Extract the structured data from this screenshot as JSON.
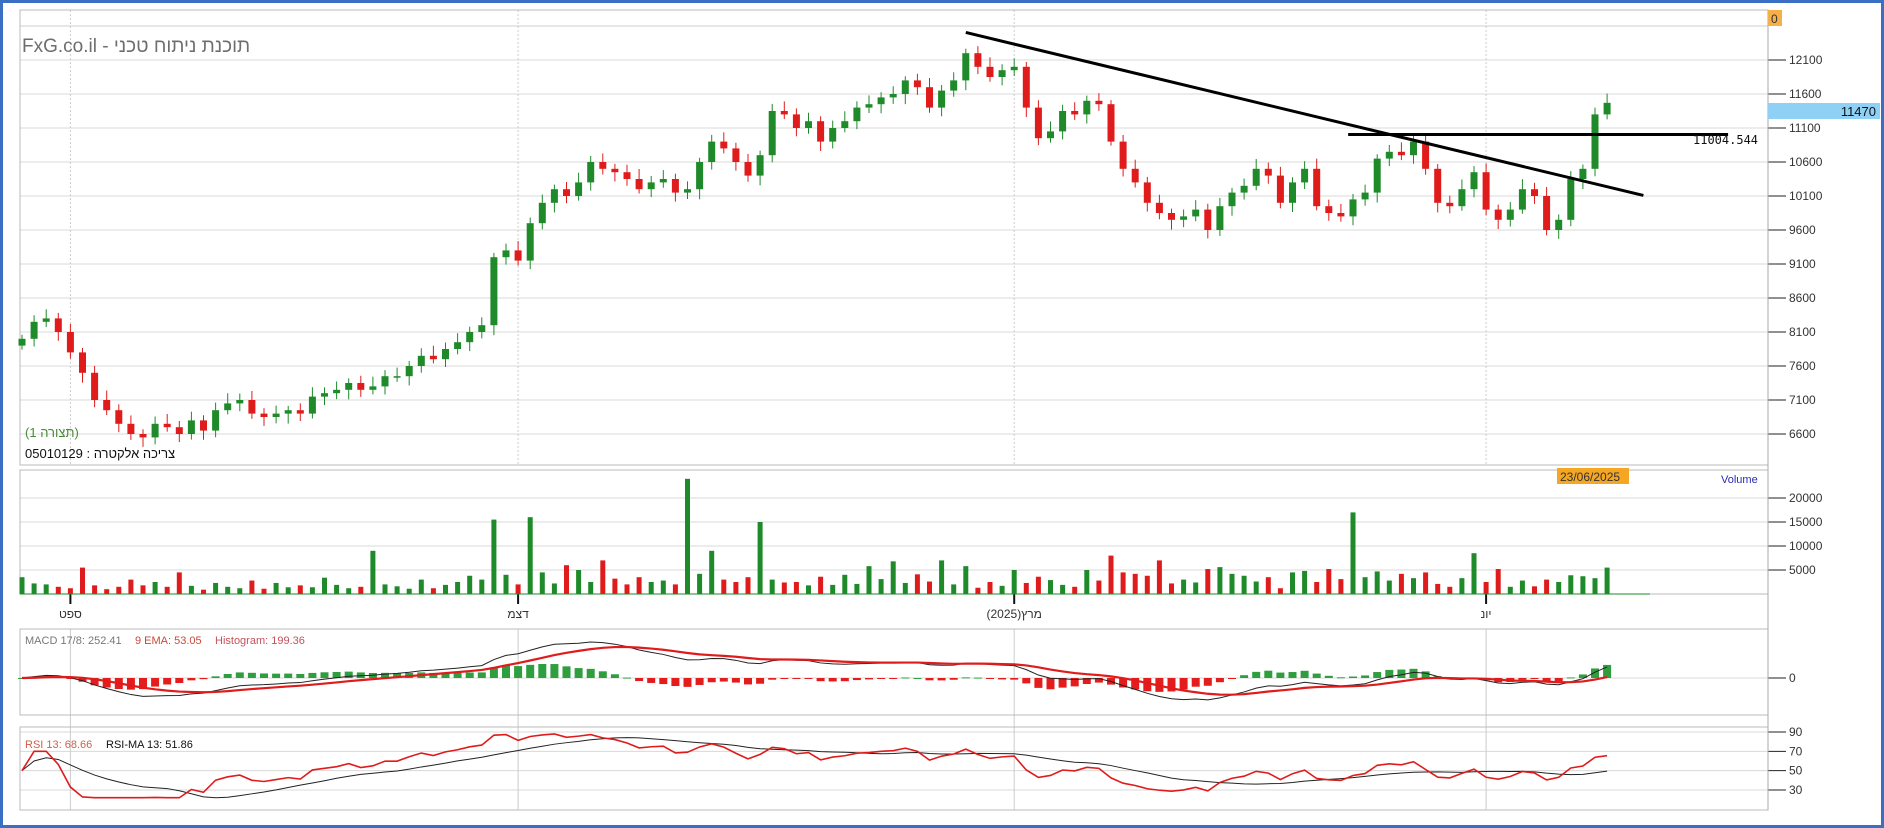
{
  "header": {
    "title": "FxG.co.il - תוכנת ניתוח טכני",
    "layout_label": "(תצורה 1)",
    "instrument": "05010129 : צריכה אלקטרה",
    "top_badge": "0",
    "last_price_badge": "11470",
    "date_badge": "23/06/2025",
    "volume_label": "Volume",
    "hline_label": "11004.544"
  },
  "indicators": {
    "macd_label": "MACD 17/8: 252.41",
    "ema_label": "9 EMA: 53.05",
    "hist_label": "Histogram: 199.36",
    "rsi_label": "RSI 13: 68.66",
    "rsima_label": "RSI-MA 13: 51.86"
  },
  "colors": {
    "up": "#1e8a2a",
    "down": "#e01b1b",
    "trend": "#000000",
    "badge": "#f5b04a",
    "price_badge": "#8fd0f5",
    "volume_text": "#2b2bb0"
  },
  "chart_data": {
    "type": "candlestick",
    "price_ticks": [
      12100,
      11600,
      11100,
      10600,
      10100,
      9600,
      9100,
      8600,
      8100,
      7600,
      7100,
      6600
    ],
    "volume_ticks": [
      20000,
      15000,
      10000,
      5000
    ],
    "macd_ticks": [
      0
    ],
    "rsi_ticks": [
      90,
      70,
      50,
      30
    ],
    "months": [
      {
        "label": "ספט",
        "index": 4
      },
      {
        "label": "דצמ",
        "index": 41
      },
      {
        "label": "מרץ(2025)",
        "index": 82
      },
      {
        "label": "יונ",
        "index": 121
      }
    ],
    "close": [
      8000,
      8250,
      8300,
      8100,
      7800,
      7500,
      7100,
      6950,
      6750,
      6600,
      6550,
      6750,
      6700,
      6600,
      6800,
      6650,
      6950,
      7050,
      7100,
      6900,
      6850,
      6900,
      6950,
      6900,
      7150,
      7200,
      7250,
      7350,
      7250,
      7300,
      7450,
      7450,
      7600,
      7750,
      7700,
      7850,
      7950,
      8100,
      8200,
      9200,
      9300,
      9150,
      9700,
      10000,
      10200,
      10100,
      10300,
      10600,
      10500,
      10450,
      10350,
      10200,
      10300,
      10350,
      10150,
      10200,
      10600,
      10900,
      10800,
      10600,
      10400,
      10700,
      11350,
      11300,
      11100,
      11200,
      10900,
      11100,
      11200,
      11400,
      11450,
      11550,
      11600,
      11800,
      11700,
      11400,
      11650,
      11800,
      12200,
      12000,
      11850,
      11950,
      12000,
      11400,
      10950,
      11050,
      11350,
      11300,
      11500,
      11450,
      10900,
      10500,
      10300,
      10000,
      9850,
      9750,
      9800,
      9900,
      9600,
      9950,
      10150,
      10250,
      10500,
      10400,
      10000,
      10300,
      10500,
      9950,
      9850,
      9800,
      10050,
      10150,
      10650,
      10750,
      10700,
      10900,
      10500,
      10000,
      9950,
      10200,
      10450,
      9900,
      9750,
      9900,
      10200,
      10100,
      9600,
      9750,
      10350,
      10500,
      11300,
      11470
    ],
    "volume": [
      3500,
      2200,
      2000,
      1500,
      1200,
      5500,
      1800,
      1000,
      1500,
      3000,
      1800,
      2500,
      1500,
      4500,
      1700,
      900,
      2300,
      1500,
      1200,
      2800,
      1100,
      2300,
      1400,
      1800,
      1400,
      3400,
      1900,
      1200,
      1500,
      9000,
      2000,
      1600,
      1100,
      3000,
      1200,
      1900,
      2500,
      3800,
      3000,
      15500,
      4000,
      2000,
      16000,
      4500,
      2200,
      6000,
      5000,
      2500,
      7000,
      3200,
      2000,
      3500,
      2500,
      2800,
      2000,
      24000,
      4200,
      9000,
      3000,
      2500,
      3500,
      15000,
      3000,
      2400,
      2500,
      1800,
      3600,
      1900,
      4000,
      2100,
      5800,
      3100,
      6800,
      2300,
      4100,
      2600,
      7000,
      2000,
      5800,
      1300,
      2500,
      1700,
      5000,
      2300,
      3600,
      2900,
      1900,
      1500,
      5000,
      2800,
      8000,
      4500,
      4200,
      3800,
      7000,
      2200,
      3000,
      2400,
      5200,
      5600,
      4200,
      3800,
      2600,
      3500,
      1200,
      4500,
      4800,
      2500,
      5200,
      3100,
      17000,
      3500,
      4700,
      2800,
      4200,
      3300,
      4500,
      2100,
      1500,
      3300,
      8500,
      2500,
      5200,
      1500,
      2800,
      1600,
      3000,
      2500,
      3900,
      3700,
      3300,
      5500
    ],
    "trendlines": [
      {
        "kind": "descending",
        "from": {
          "index": 78,
          "price": 12505
        },
        "to": {
          "index": 134,
          "price": 10108
        }
      },
      {
        "kind": "horizontal",
        "from": {
          "index": 109.6,
          "price": 11004.544
        },
        "to": {
          "index": 141,
          "price": 11004.544
        }
      }
    ]
  }
}
